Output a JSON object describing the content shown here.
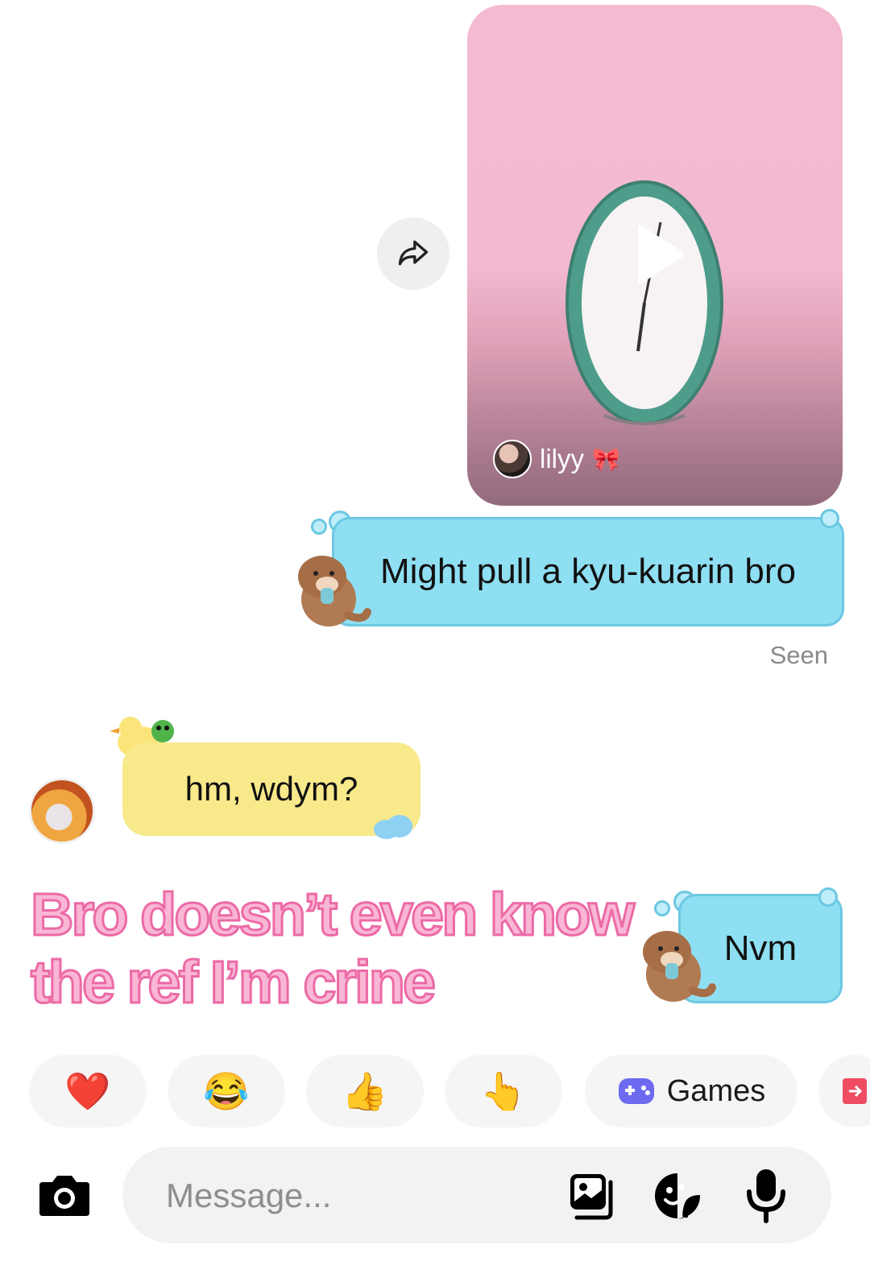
{
  "shared_reel": {
    "author": "lilyy",
    "author_decoration": "🎀",
    "icons": {
      "share": "share-arrow-icon",
      "play": "play-icon"
    }
  },
  "messages": [
    {
      "sender": "me",
      "text": "Might pull a kyu-kuarin bro"
    },
    {
      "sender": "other",
      "text": "hm, wdym?"
    },
    {
      "sender": "me",
      "text": "Nvm"
    }
  ],
  "status": {
    "seen": "Seen"
  },
  "overlay_caption": "Bro doesn’t even know the ref I’m crine",
  "reactions": {
    "heart": "❤️",
    "laugh": "😂",
    "thumbs_up": "👍",
    "point": "👆",
    "games": "Games"
  },
  "composer": {
    "placeholder": "Message...",
    "icons": [
      "camera-icon",
      "gallery-icon",
      "sticker-icon",
      "microphone-icon"
    ]
  },
  "colors": {
    "my_bubble": "#8fdff3",
    "their_bubble": "#f8e98b",
    "caption_fill": "#f9b6d5",
    "caption_stroke": "#ec6aa6"
  }
}
